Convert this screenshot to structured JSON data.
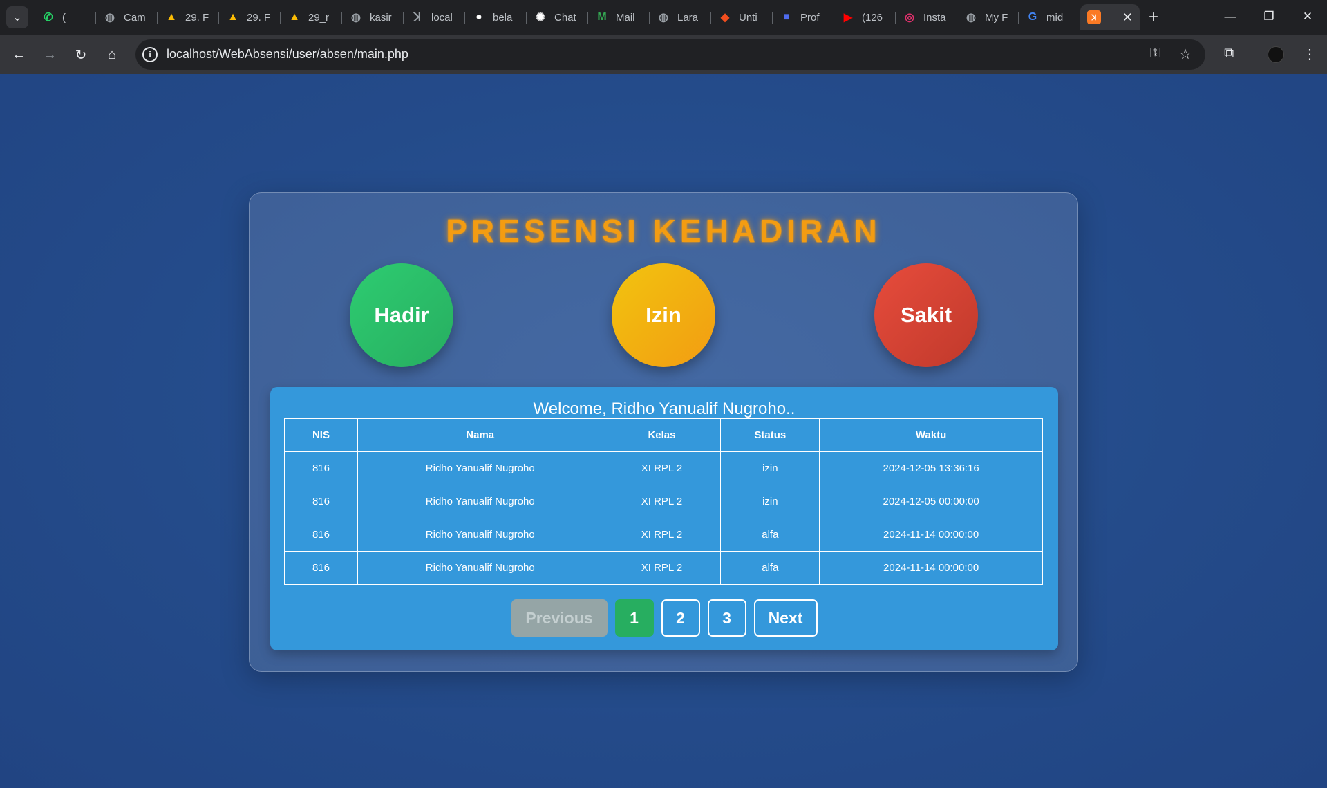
{
  "browser": {
    "tabs": [
      {
        "title": "(",
        "icon": "whatsapp-icon",
        "color": "#25d366"
      },
      {
        "title": "Cam",
        "icon": "globe-icon",
        "color": "#9aa0a6"
      },
      {
        "title": "29. F",
        "icon": "drive-icon",
        "color": "#fbbc04"
      },
      {
        "title": "29. F",
        "icon": "drive-icon",
        "color": "#fbbc04"
      },
      {
        "title": "29_r",
        "icon": "drive-icon",
        "color": "#fbbc04"
      },
      {
        "title": "kasir",
        "icon": "globe-icon",
        "color": "#9aa0a6"
      },
      {
        "title": "local",
        "icon": "xampp-icon",
        "color": "#9aa0a6"
      },
      {
        "title": "bela",
        "icon": "github-icon",
        "color": "#ffffff"
      },
      {
        "title": "Chat",
        "icon": "chatgpt-icon",
        "color": "#ffffff"
      },
      {
        "title": "Mail",
        "icon": "mail-icon",
        "color": "#34a853"
      },
      {
        "title": "Lara",
        "icon": "globe-icon",
        "color": "#9aa0a6"
      },
      {
        "title": "Unti",
        "icon": "figma-icon",
        "color": "#f24e1e"
      },
      {
        "title": "Prof",
        "icon": "profile-icon",
        "color": "#4f6bed"
      },
      {
        "title": "(126",
        "icon": "youtube-icon",
        "color": "#ff0000"
      },
      {
        "title": "Insta",
        "icon": "instagram-icon",
        "color": "#e1306c"
      },
      {
        "title": "My F",
        "icon": "globe-icon",
        "color": "#9aa0a6"
      },
      {
        "title": "mid",
        "icon": "google-icon",
        "color": "#4285f4"
      }
    ],
    "active_tab_icon": "xampp-icon",
    "url": "localhost/WebAbsensi/user/absen/main.php"
  },
  "page": {
    "title": "PRESENSI KEHADIRAN",
    "buttons": {
      "hadir": "Hadir",
      "izin": "Izin",
      "sakit": "Sakit"
    },
    "welcome": "Welcome, Ridho Yanualif Nugroho..",
    "table": {
      "headers": [
        "NIS",
        "Nama",
        "Kelas",
        "Status",
        "Waktu"
      ],
      "rows": [
        [
          "816",
          "Ridho Yanualif Nugroho",
          "XI RPL 2",
          "izin",
          "2024-12-05 13:36:16"
        ],
        [
          "816",
          "Ridho Yanualif Nugroho",
          "XI RPL 2",
          "izin",
          "2024-12-05 00:00:00"
        ],
        [
          "816",
          "Ridho Yanualif Nugroho",
          "XI RPL 2",
          "alfa",
          "2024-11-14 00:00:00"
        ],
        [
          "816",
          "Ridho Yanualif Nugroho",
          "XI RPL 2",
          "alfa",
          "2024-11-14 00:00:00"
        ]
      ]
    },
    "pagination": {
      "previous": "Previous",
      "pages": [
        "1",
        "2",
        "3"
      ],
      "current": "1",
      "next": "Next"
    },
    "colors": {
      "title": "#f39c12",
      "hadir": "#2ecc71",
      "izin": "#f1c40f",
      "sakit": "#e74c3c",
      "panel": "#3498db",
      "current_page": "#27ae60",
      "background": "#22467f"
    }
  }
}
